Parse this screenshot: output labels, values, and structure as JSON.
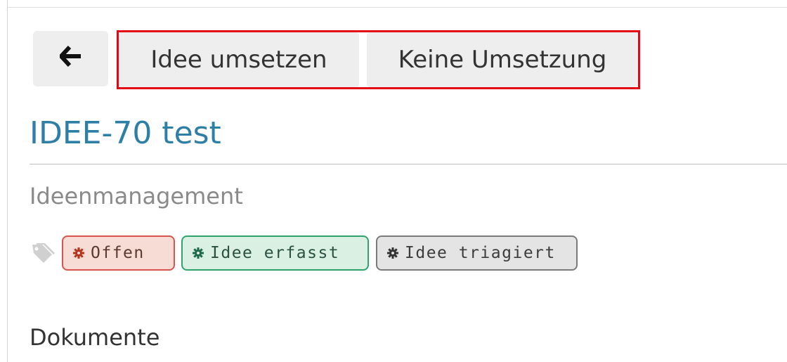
{
  "toolbar": {
    "back_icon": "arrow-left-icon",
    "actions": [
      {
        "label": "Idee umsetzen"
      },
      {
        "label": "Keine Umsetzung"
      }
    ],
    "highlight_color": "#e30613"
  },
  "issue": {
    "title": "IDEE-70 test",
    "title_color": "#2d7fa6",
    "project": "Ideenmanagement"
  },
  "tags": {
    "icon": "tags-icon",
    "items": [
      {
        "label": "Offen",
        "icon": "gear-icon",
        "bg": "#f7dcd6",
        "border": "#d9534f"
      },
      {
        "label": "Idee erfasst",
        "icon": "gear-icon",
        "bg": "#d9f0e3",
        "border": "#2fa36b"
      },
      {
        "label": "Idee triagiert",
        "icon": "gear-icon",
        "bg": "#e4e4e4",
        "border": "#7b7b7b"
      }
    ]
  },
  "sections": {
    "documents": "Dokumente"
  }
}
